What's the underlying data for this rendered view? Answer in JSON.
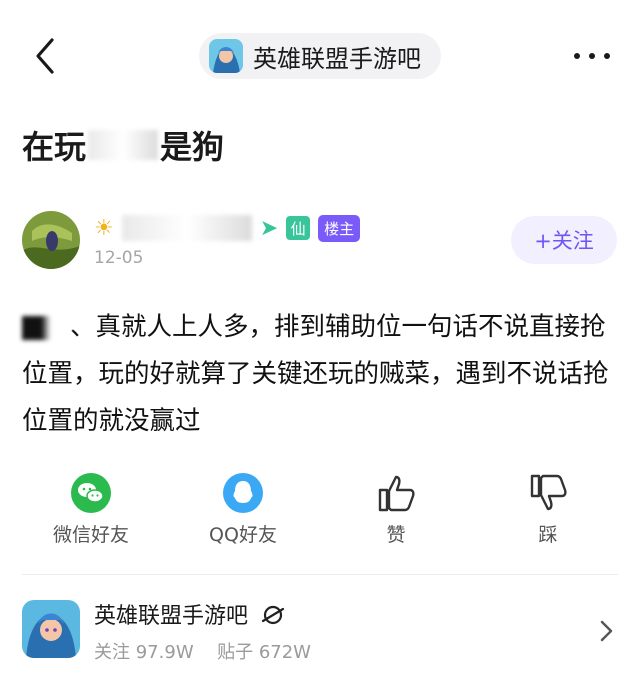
{
  "header": {
    "forum_name": "英雄联盟手游吧",
    "back_icon": "chevron-left-icon",
    "more_icon": "more-dots-icon"
  },
  "post": {
    "title_start": "在玩",
    "title_end": "是狗",
    "author_badge": "楼主",
    "author_badge_2": "仙",
    "date": "12-05",
    "follow_label": "+关注",
    "content": "、真就人上人多，排到辅助位一句话不说直接抢位置，玩的好就算了关键还玩的贼菜，遇到不说话抢位置的就没赢过"
  },
  "share": {
    "wechat": "微信好友",
    "qq": "QQ好友",
    "like": "赞",
    "dislike": "踩"
  },
  "forum_card": {
    "name": "英雄联盟手游吧",
    "follow_label": "关注",
    "follow_count": "97.9W",
    "posts_label": "贴子",
    "posts_count": "672W"
  },
  "colors": {
    "accent": "#7a5af8",
    "wechat_green": "#2bba4e",
    "qq_blue": "#3aa8f5"
  }
}
